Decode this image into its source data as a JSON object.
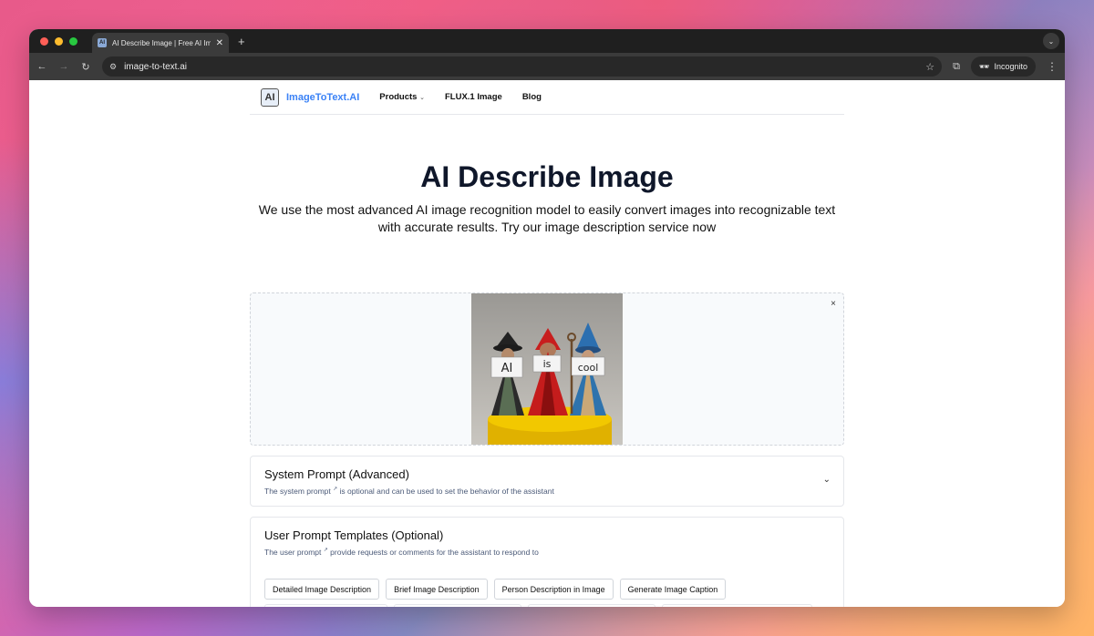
{
  "browser": {
    "tab": {
      "title": "AI Describe Image | Free AI Im",
      "favicon_text": "AI",
      "close": "✕"
    },
    "new_tab": "+",
    "url": "image-to-text.ai",
    "incognito_label": "Incognito"
  },
  "site": {
    "logo_text": "ImageToText.AI",
    "logo_mark": "AI",
    "nav": {
      "products": "Products",
      "flux": "FLUX.1 Image",
      "blog": "Blog"
    }
  },
  "hero": {
    "title": "AI Describe Image",
    "subtitle": "We use the most advanced AI image recognition model to easily convert images into recognizable text with accurate results. Try our image description service now"
  },
  "upload": {
    "close": "×",
    "signs": [
      "AI",
      "is",
      "cool"
    ]
  },
  "system_prompt": {
    "title": "System Prompt (Advanced)",
    "desc_before": "The system prompt",
    "desc_after": "is optional and can be used to set the behavior of the assistant"
  },
  "user_prompt": {
    "title": "User Prompt Templates (Optional)",
    "desc_before": "The user prompt",
    "desc_after": "provide requests or comments for the assistant to respond to",
    "templates": [
      "Detailed Image Description",
      "Brief Image Description",
      "Person Description in Image",
      "Generate Image Caption"
    ]
  },
  "colors": {
    "brand_blue": "#3b82f6",
    "title_dark": "#0f172a"
  }
}
